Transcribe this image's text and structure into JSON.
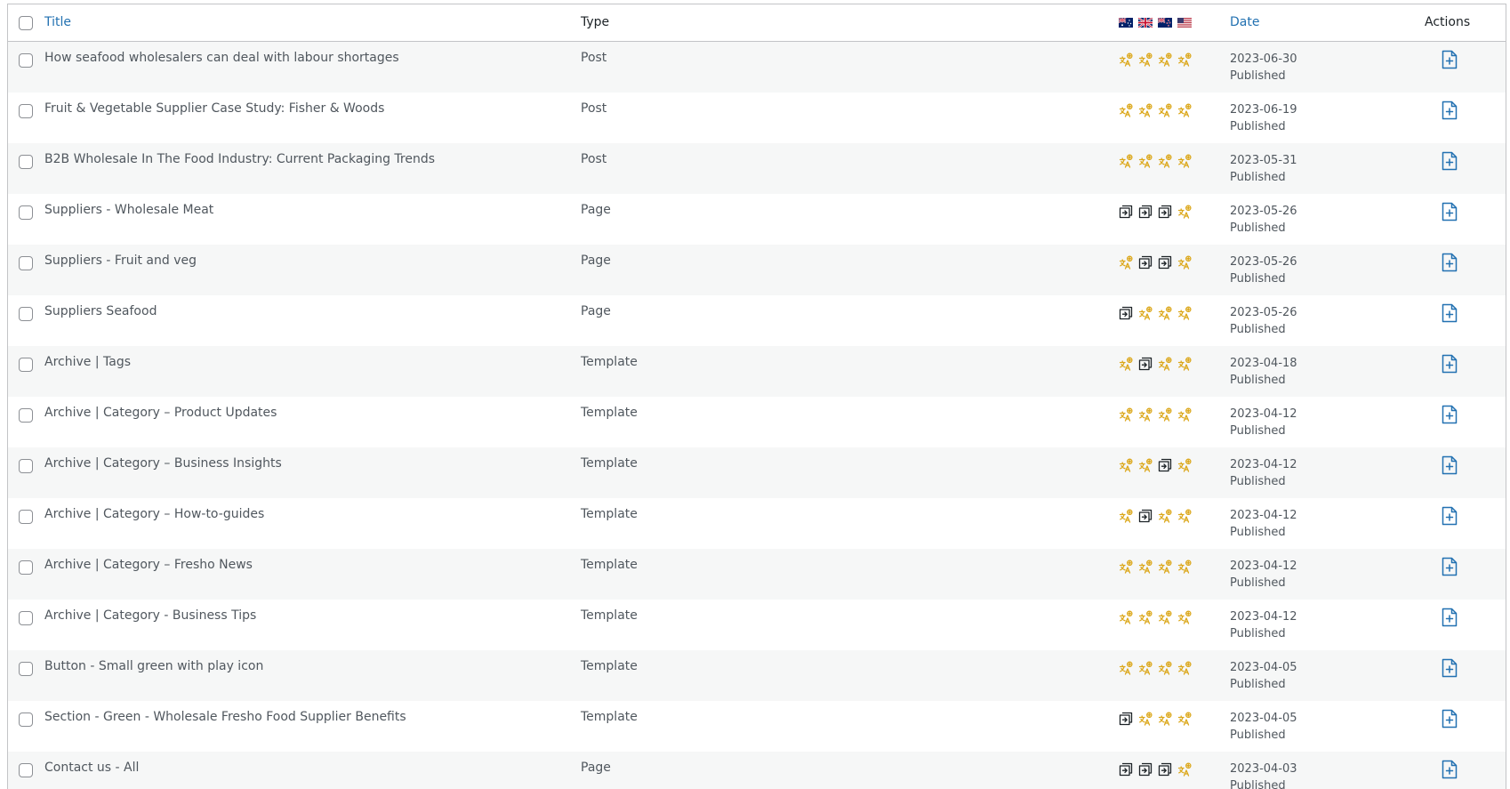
{
  "header": {
    "title_label": "Title",
    "type_label": "Type",
    "date_label": "Date",
    "actions_label": "Actions",
    "languages": [
      {
        "flag": "au-flag-icon"
      },
      {
        "flag": "gb-flag-icon"
      },
      {
        "flag": "nz-flag-icon"
      },
      {
        "flag": "us-flag-icon"
      }
    ]
  },
  "colors": {
    "link": "#2271b1",
    "text": "#50575e",
    "translate_icon": "#dba617",
    "dark_icon": "#1d2327",
    "row_alt": "#f6f7f7",
    "border": "#c3c4c7"
  },
  "icons": {
    "translate": "translate-needed-icon",
    "linked": "translation-linked-icon",
    "action": "add-translation-icon"
  },
  "rows": [
    {
      "title": "How seafood wholesalers can deal with labour shortages",
      "type": "Post",
      "date": "2023-06-30",
      "status": "Published",
      "langs": [
        "t",
        "t",
        "t",
        "t"
      ]
    },
    {
      "title": "Fruit & Vegetable Supplier Case Study: Fisher & Woods",
      "type": "Post",
      "date": "2023-06-19",
      "status": "Published",
      "langs": [
        "t",
        "t",
        "t",
        "t"
      ]
    },
    {
      "title": "B2B Wholesale In The Food Industry: Current Packaging Trends",
      "type": "Post",
      "date": "2023-05-31",
      "status": "Published",
      "langs": [
        "t",
        "t",
        "t",
        "t"
      ]
    },
    {
      "title": "Suppliers - Wholesale Meat",
      "type": "Page",
      "date": "2023-05-26",
      "status": "Published",
      "langs": [
        "l",
        "l",
        "l",
        "t"
      ]
    },
    {
      "title": "Suppliers - Fruit and veg",
      "type": "Page",
      "date": "2023-05-26",
      "status": "Published",
      "langs": [
        "t",
        "l",
        "l",
        "t"
      ]
    },
    {
      "title": "Suppliers Seafood",
      "type": "Page",
      "date": "2023-05-26",
      "status": "Published",
      "langs": [
        "l",
        "t",
        "t",
        "t"
      ]
    },
    {
      "title": "Archive | Tags",
      "type": "Template",
      "date": "2023-04-18",
      "status": "Published",
      "langs": [
        "t",
        "l",
        "t",
        "t"
      ]
    },
    {
      "title": "Archive | Category – Product Updates",
      "type": "Template",
      "date": "2023-04-12",
      "status": "Published",
      "langs": [
        "t",
        "t",
        "t",
        "t"
      ]
    },
    {
      "title": "Archive | Category – Business Insights",
      "type": "Template",
      "date": "2023-04-12",
      "status": "Published",
      "langs": [
        "t",
        "t",
        "l",
        "t"
      ]
    },
    {
      "title": "Archive | Category – How-to-guides",
      "type": "Template",
      "date": "2023-04-12",
      "status": "Published",
      "langs": [
        "t",
        "l",
        "t",
        "t"
      ]
    },
    {
      "title": "Archive | Category – Fresho News",
      "type": "Template",
      "date": "2023-04-12",
      "status": "Published",
      "langs": [
        "t",
        "t",
        "t",
        "t"
      ]
    },
    {
      "title": "Archive | Category - Business Tips",
      "type": "Template",
      "date": "2023-04-12",
      "status": "Published",
      "langs": [
        "t",
        "t",
        "t",
        "t"
      ]
    },
    {
      "title": "Button - Small green with play icon",
      "type": "Template",
      "date": "2023-04-05",
      "status": "Published",
      "langs": [
        "t",
        "t",
        "t",
        "t"
      ]
    },
    {
      "title": "Section - Green - Wholesale Fresho Food Supplier Benefits",
      "type": "Template",
      "date": "2023-04-05",
      "status": "Published",
      "langs": [
        "l",
        "t",
        "t",
        "t"
      ]
    },
    {
      "title": "Contact us - All",
      "type": "Page",
      "date": "2023-04-03",
      "status": "Published",
      "langs": [
        "l",
        "l",
        "l",
        "t"
      ]
    }
  ]
}
